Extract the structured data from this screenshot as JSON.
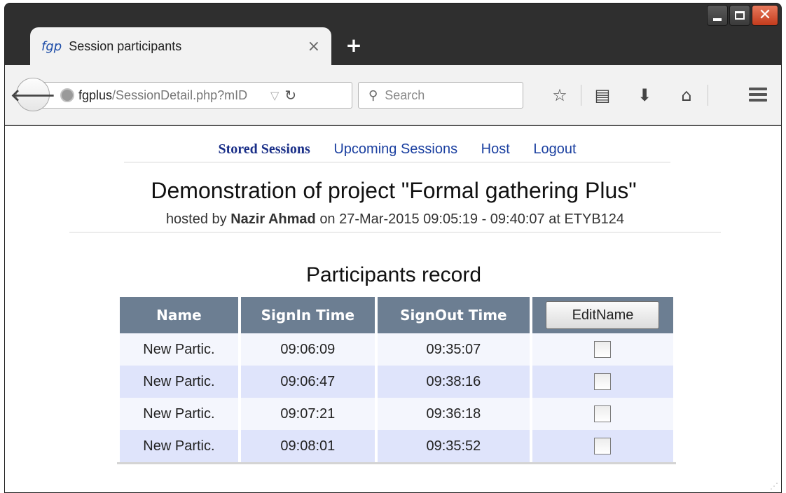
{
  "browser": {
    "tab": {
      "favicon_text": "fgp",
      "title": "Session participants",
      "close": "×"
    },
    "new_tab": "+",
    "url": {
      "host": "fgplus",
      "path": "/SessionDetail.php?mID"
    },
    "search_placeholder": "Search",
    "window_controls": {
      "close": "✕"
    }
  },
  "nav": {
    "items": [
      "Stored Sessions",
      "Upcoming Sessions",
      "Host",
      "Logout"
    ]
  },
  "session": {
    "title": "Demonstration of project \"Formal gathering Plus\"",
    "sub_prefix": "hosted by",
    "host": "Nazir Ahmad",
    "sub_suffix": "on 27-Mar-2015 09:05:19 - 09:40:07 at ETYB124"
  },
  "participants": {
    "title": "Participants record",
    "columns": [
      "Name",
      "SignIn Time",
      "SignOut Time"
    ],
    "edit_button": "EditName",
    "rows": [
      {
        "name": "New Partic.",
        "signin": "09:06:09",
        "signout": "09:35:07",
        "checked": false
      },
      {
        "name": "New Partic.",
        "signin": "09:06:47",
        "signout": "09:38:16",
        "checked": false
      },
      {
        "name": "New Partic.",
        "signin": "09:07:21",
        "signout": "09:36:18",
        "checked": false
      },
      {
        "name": "New Partic.",
        "signin": "09:08:01",
        "signout": "09:35:52",
        "checked": false
      }
    ]
  }
}
